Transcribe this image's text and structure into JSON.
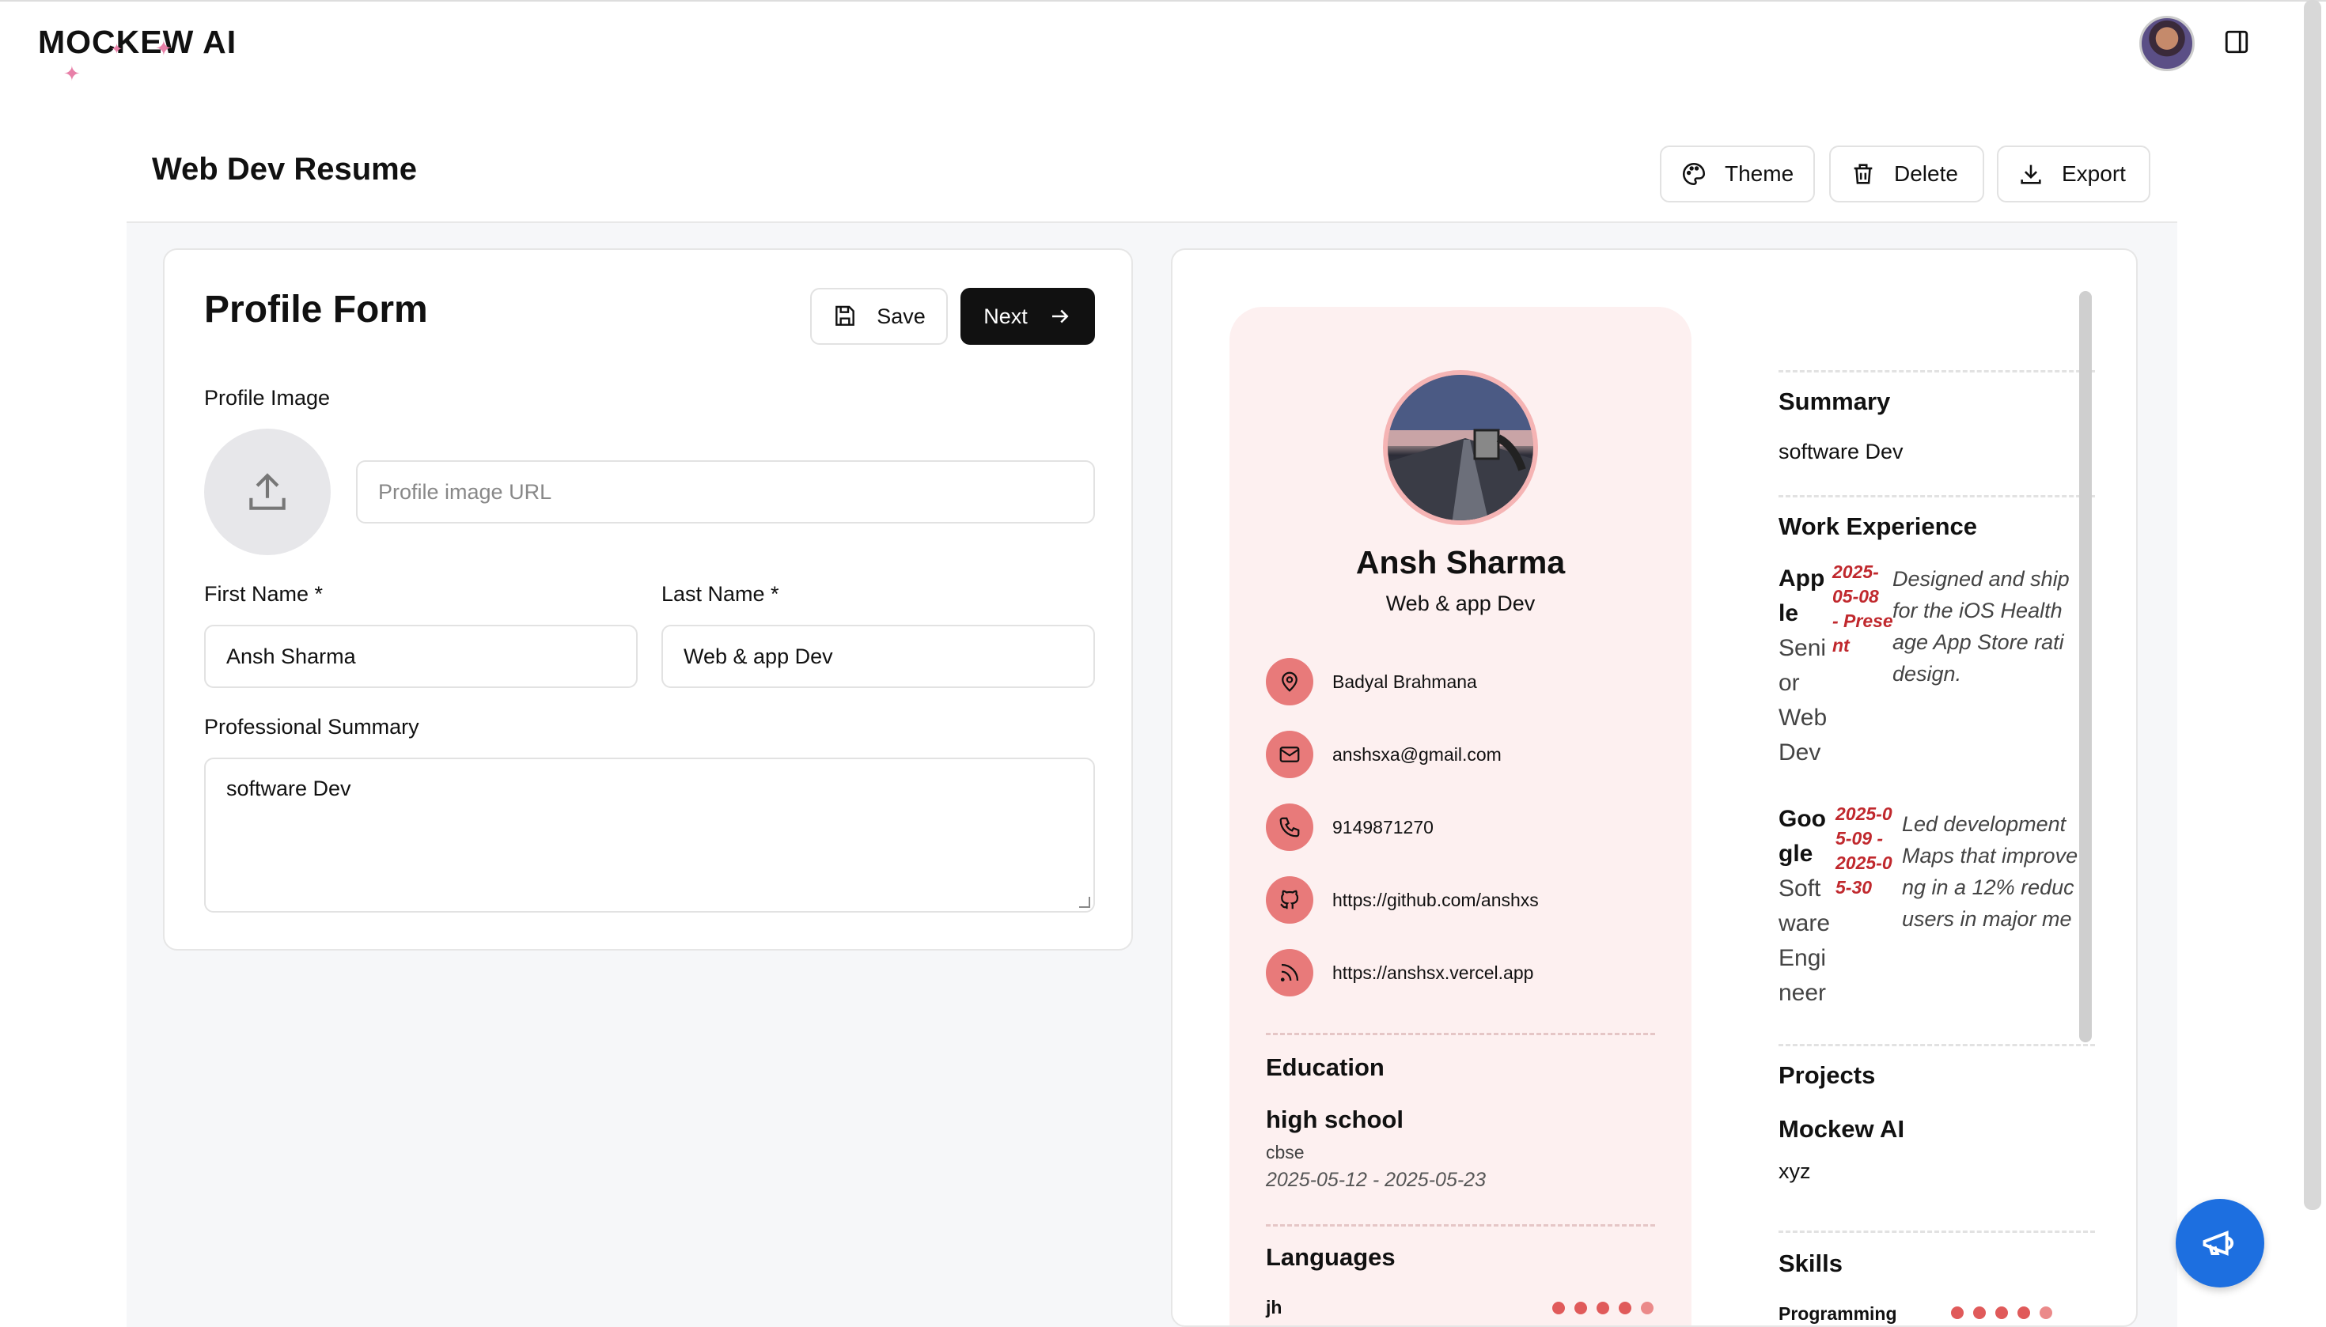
{
  "app": {
    "logo": "MOCKEW AI"
  },
  "header": {
    "title": "Web Dev Resume",
    "theme": "Theme",
    "delete": "Delete",
    "export": "Export"
  },
  "form": {
    "title": "Profile Form",
    "save": "Save",
    "next": "Next",
    "profile_image_label": "Profile Image",
    "profile_image_placeholder": "Profile image URL",
    "first_name_label": "First Name *",
    "first_name_value": "Ansh Sharma",
    "last_name_label": "Last Name *",
    "last_name_value": "Web & app Dev",
    "summary_label": "Professional Summary",
    "summary_value": "software Dev"
  },
  "resume": {
    "name": "Ansh Sharma",
    "role": "Web & app Dev",
    "contacts": [
      {
        "icon": "location-icon",
        "text": "Badyal Brahmana"
      },
      {
        "icon": "mail-icon",
        "text": "anshsxa@gmail.com"
      },
      {
        "icon": "phone-icon",
        "text": "9149871270"
      },
      {
        "icon": "github-icon",
        "text": "https://github.com/anshxs"
      },
      {
        "icon": "rss-icon",
        "text": "https://anshsx.vercel.app"
      }
    ],
    "education_heading": "Education",
    "education": {
      "degree": "high school",
      "board": "cbse",
      "dates": "2025-05-12 - 2025-05-23"
    },
    "languages_heading": "Languages",
    "languages": [
      {
        "name": "jh",
        "level": 5
      }
    ],
    "summary_heading": "Summary",
    "summary": "software Dev",
    "work_heading": "Work Experience",
    "work": [
      {
        "company_lines": [
          "App",
          "le"
        ],
        "title_lines": [
          "Seni",
          "or",
          "Web",
          "Dev"
        ],
        "date_lines": [
          "2025-",
          "05-08",
          "- Prese",
          "nt"
        ],
        "desc_lines": [
          "Designed and ship",
          "for the iOS Health",
          "age App Store rati",
          "design."
        ]
      },
      {
        "company_lines": [
          "Goo",
          "gle"
        ],
        "title_lines": [
          "Soft",
          "ware",
          "Engi",
          "neer"
        ],
        "date_lines": [
          "2025-0",
          "5-09 -",
          "2025-0",
          "5-30"
        ],
        "desc_lines": [
          "Led development",
          "Maps that improve",
          "ng in a 12% reduc",
          "users in major me"
        ]
      }
    ],
    "projects_heading": "Projects",
    "project": {
      "name": "Mockew AI",
      "desc": "xyz"
    },
    "skills_heading": "Skills",
    "skills": [
      {
        "name": "Programming",
        "level": 5
      }
    ]
  },
  "colors": {
    "accent": "#e87a7a",
    "dark": "#111111",
    "fab": "#1d6fe0",
    "resume_bg": "#fdf0f0",
    "date": "#c0282d"
  }
}
